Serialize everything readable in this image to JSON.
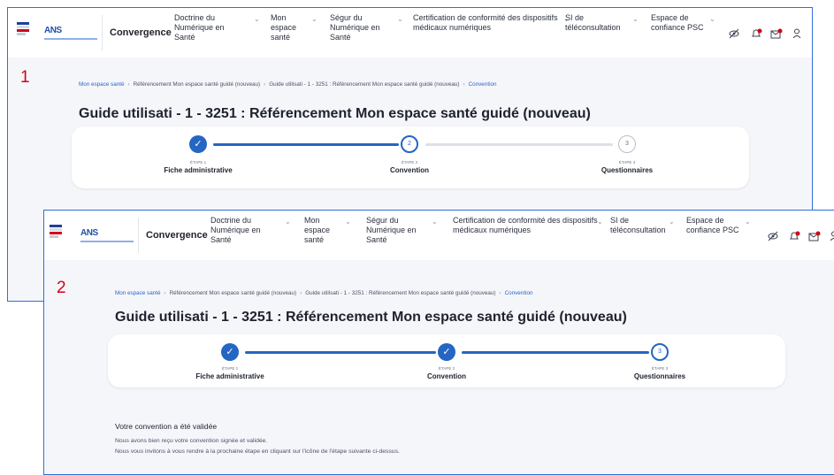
{
  "header": {
    "brand": "Convergence",
    "nav": [
      "Doctrine du Numérique en Santé",
      "Mon espace santé",
      "Ségur du Numérique en Santé",
      "Certification de conformité des dispositifs médicaux numériques",
      "SI de téléconsultation",
      "Espace de confiance PSC"
    ],
    "icons": [
      "eye-off-icon",
      "bell-icon",
      "mail-icon",
      "user-icon"
    ],
    "logo_text": "ANS"
  },
  "shots": [
    {
      "number": "1",
      "breadcrumb": [
        "Mon espace santé",
        "Référencement Mon espace santé guidé (nouveau)",
        "Guide utilisati - 1 - 3251 : Référencement Mon espace santé guidé (nouveau)",
        "Convention"
      ],
      "title": "Guide utilisati - 1 - 3251 : Référencement Mon espace santé guidé (nouveau)",
      "steps": [
        {
          "index": "✓",
          "small": "ÉTAPE 1",
          "name": "Fiche administrative",
          "state": "done"
        },
        {
          "index": "2",
          "small": "ÉTAPE 2",
          "name": "Convention",
          "state": "current"
        },
        {
          "index": "3",
          "small": "ÉTAPE 3",
          "name": "Questionnaires",
          "state": "todo"
        }
      ]
    },
    {
      "number": "2",
      "breadcrumb": [
        "Mon espace santé",
        "Référencement Mon espace santé guidé (nouveau)",
        "Guide utilisati - 1 - 3251 : Référencement Mon espace santé guidé (nouveau)",
        "Convention"
      ],
      "title": "Guide utilisati - 1 - 3251 : Référencement Mon espace santé guidé (nouveau)",
      "steps": [
        {
          "index": "✓",
          "small": "ÉTAPE 1",
          "name": "Fiche administrative",
          "state": "done"
        },
        {
          "index": "✓",
          "small": "ÉTAPE 2",
          "name": "Convention",
          "state": "done"
        },
        {
          "index": "3",
          "small": "ÉTAPE 3",
          "name": "Questionnaires",
          "state": "current"
        }
      ],
      "confirmation": {
        "title": "Votre convention a été validée",
        "lines": [
          "Nous avons bien reçu votre convention signée et validée.",
          "Nous vous invitons à vous rendre à la prochaine étape en cliquant sur l'icône de l'étape suivante ci-dessus."
        ]
      }
    }
  ],
  "colors": {
    "primary": "#2466c2",
    "annotation": "#d0021b",
    "frame": "#2f6fd6"
  }
}
